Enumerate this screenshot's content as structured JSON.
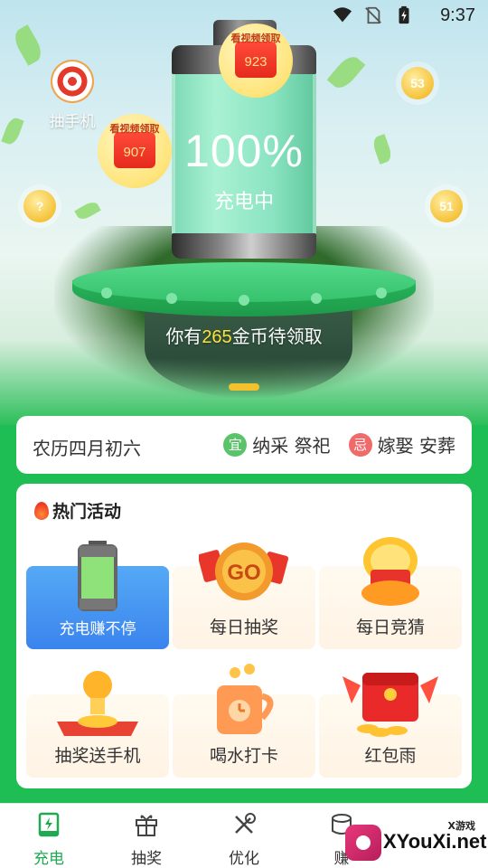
{
  "status_bar": {
    "time": "9:37",
    "icons": [
      "wifi-icon",
      "no-sim-icon",
      "battery-charging-icon"
    ]
  },
  "hero": {
    "battery_percent": "100%",
    "battery_status": "充电中",
    "lottery_label": "抽手机",
    "red_packets": [
      {
        "tag": "看视频领取",
        "amount": "923"
      },
      {
        "tag": "看视频领取",
        "amount": "907"
      }
    ],
    "coins": [
      "53",
      "?",
      "51"
    ],
    "coins_text_prefix": "你有",
    "coins_value": "265",
    "coins_text_suffix": "金币待领取"
  },
  "almanac": {
    "lunar_date": "农历四月初六",
    "yi_badge": "宜",
    "yi_text": "纳采 祭祀",
    "ji_badge": "忌",
    "ji_text": "嫁娶 安葬"
  },
  "activities": {
    "title": "热门活动",
    "items": [
      {
        "label": "充电赚不停",
        "icon": "battery-icon",
        "highlighted": true
      },
      {
        "label": "每日抽奖",
        "icon": "go-coin-icon"
      },
      {
        "label": "每日竞猜",
        "icon": "golden-egg-icon"
      },
      {
        "label": "抽奖送手机",
        "icon": "coin-box-icon"
      },
      {
        "label": "喝水打卡",
        "icon": "cup-icon"
      },
      {
        "label": "红包雨",
        "icon": "red-envelope-icon"
      }
    ]
  },
  "bottom_nav": {
    "items": [
      {
        "label": "充电",
        "icon": "charge-icon",
        "active": true
      },
      {
        "label": "抽奖",
        "icon": "gift-icon"
      },
      {
        "label": "优化",
        "icon": "tools-icon"
      },
      {
        "label": "赚",
        "icon": "coins-icon"
      }
    ]
  },
  "watermark": {
    "small": "X游戏",
    "main": "XYouXi.net"
  },
  "colors": {
    "primary_green": "#1fbe55",
    "coin_yellow": "#ffe23a",
    "highlight_blue": "#3a84ee"
  }
}
